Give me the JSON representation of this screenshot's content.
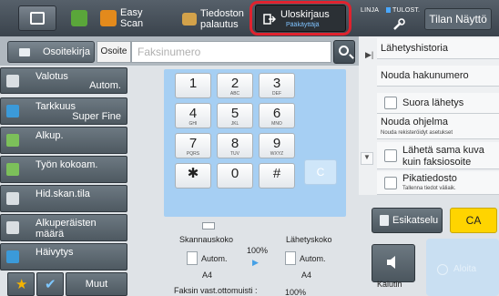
{
  "topbar": {
    "easy_scan": "Easy Scan",
    "tiedoston_line1": "Tiedoston",
    "tiedoston_line2": "palautus",
    "logout_label": "Uloskirjaus",
    "logout_sub": "Pääkäyttäjä",
    "status_line": "LINJA",
    "status_print": "TULOST.",
    "tilan_naytto": "Tilan Näyttö"
  },
  "address": {
    "osoitekirja": "Osoitekirja",
    "osoite": "Osoite",
    "placeholder": "Faksinumero"
  },
  "left_menu": [
    {
      "title": "Valotus",
      "value": "Autom."
    },
    {
      "title": "Tarkkuus",
      "value": "Super Fine"
    },
    {
      "title": "Alkup.",
      "value": ""
    },
    {
      "title": "Työn kokoam.",
      "value": ""
    },
    {
      "title": "Hid.skan.tila",
      "value": ""
    },
    {
      "title": "Alkuperäisten määrä",
      "value": ""
    },
    {
      "title": "Häivytys",
      "value": ""
    }
  ],
  "bottom_left": {
    "muut": "Muut"
  },
  "keypad": [
    {
      "n": "1",
      "l": ""
    },
    {
      "n": "2",
      "l": "ABC"
    },
    {
      "n": "3",
      "l": "DEF"
    },
    {
      "n": "4",
      "l": "GHI"
    },
    {
      "n": "5",
      "l": "JKL"
    },
    {
      "n": "6",
      "l": "MNO"
    },
    {
      "n": "7",
      "l": "PQRS"
    },
    {
      "n": "8",
      "l": "TUV"
    },
    {
      "n": "9",
      "l": "WXYZ"
    },
    {
      "n": "✱",
      "l": ""
    },
    {
      "n": "0",
      "l": ""
    },
    {
      "n": "#",
      "l": ""
    }
  ],
  "clear_key": "C",
  "bottom_center": {
    "skannauskoko": "Skannauskoko",
    "lahetyskoko": "Lähetyskoko",
    "autom_left": "Autom.",
    "autom_right": "Autom.",
    "ratio": "100%",
    "a4_left": "A4",
    "a4_right": "A4",
    "memory_label": "Faksin vast.ottomuisti :",
    "memory_value": "100%"
  },
  "right_panel": {
    "lahetyshistoria": "Lähetyshistoria",
    "nouda_hakunumero": "Nouda hakunumero",
    "suora_lahetys": "Suora lähetys",
    "nouda_ohjelma": "Nouda ohjelma",
    "nouda_ohjelma_sub": "Nouda rekisteröidyt asetukset",
    "laheta_sama_1": "Lähetä sama kuva",
    "laheta_sama_2": "kuin faksiosoite",
    "pikatiedosto": "Pikatiedosto",
    "pikatiedosto_sub": "Tallenna tiedot väliaik."
  },
  "actions": {
    "esikatselu": "Esikatselu",
    "ca": "CA",
    "kaiutin": "Kaiutin",
    "aloita": "Aloita"
  },
  "colors": {
    "highlight_ring": "#e0222e",
    "ca_button": "#ffd400",
    "keypad_bg": "#a6cff3"
  }
}
